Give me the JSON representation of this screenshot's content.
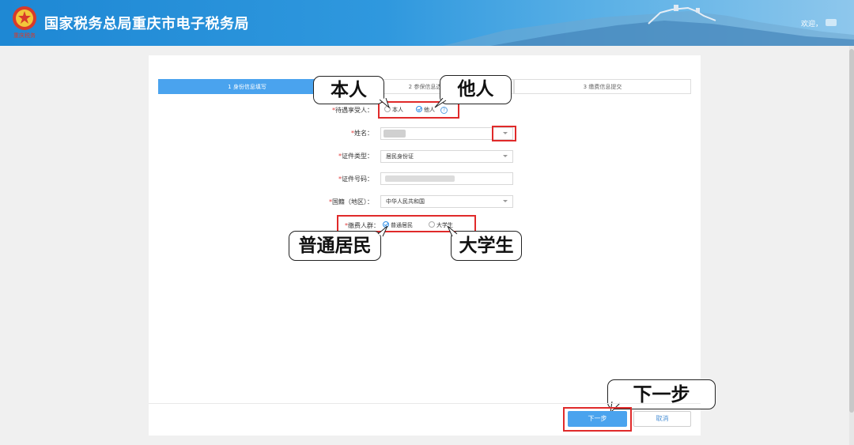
{
  "header": {
    "site_title": "国家税务总局重庆市电子税务局",
    "welcome": "欢迎，",
    "logo_text": "重庆税务"
  },
  "steps": [
    {
      "label": "1 身份信息填写",
      "active": true
    },
    {
      "label": "2 参保信息选",
      "active": false
    },
    {
      "label": "3 缴费信息提交",
      "active": false
    }
  ],
  "form": {
    "beneficiary": {
      "label": "待遇享受人：",
      "options": [
        "本人",
        "他人"
      ],
      "selected": "他人",
      "help": "?"
    },
    "name": {
      "label": "姓名："
    },
    "id_type": {
      "label": "证件类型：",
      "value": "居民身份证"
    },
    "id_number": {
      "label": "证件号码："
    },
    "nationality": {
      "label": "国籍（地区）：",
      "value": "中华人民共和国"
    },
    "payer_group": {
      "label": "缴费人群：",
      "options": [
        "普通居民",
        "大学生"
      ],
      "selected": "普通居民"
    },
    "required_mark": "*"
  },
  "callouts": {
    "self": "本人",
    "other": "他人",
    "resident": "普通居民",
    "student": "大学生",
    "next": "下一步"
  },
  "buttons": {
    "next": "下一步",
    "cancel": "取消"
  },
  "colors": {
    "header_start": "#1e88d4",
    "accent": "#4aa3ee",
    "highlight_red": "#e02a2a",
    "required_red": "#e23b3b"
  }
}
